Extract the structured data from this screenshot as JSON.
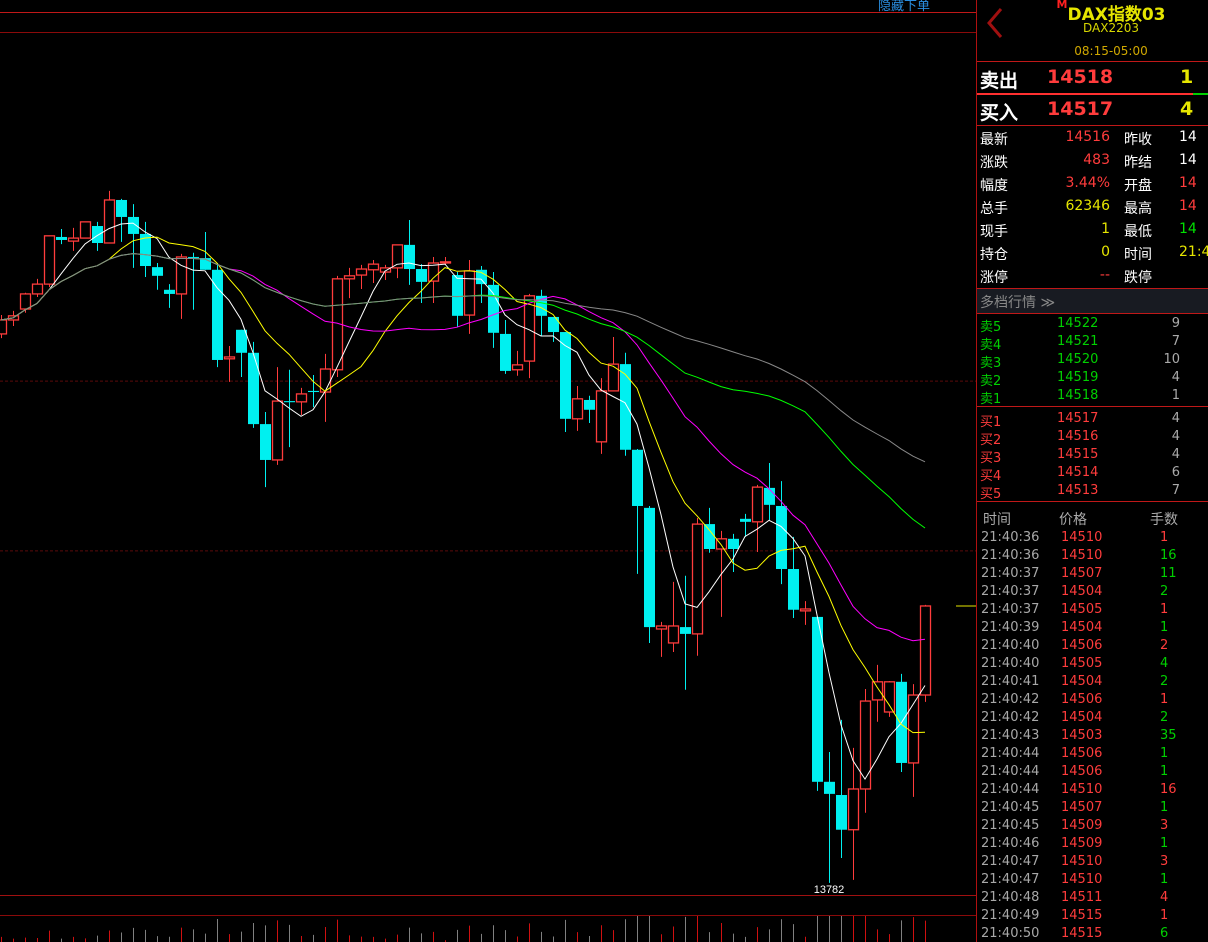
{
  "toolbar": {
    "hide_order_label": "隐藏下单"
  },
  "colors": {
    "up": "#ff3c3c",
    "down": "#00f0f0",
    "ma5": "#ffffff",
    "ma10": "#ffff00",
    "ma20": "#ff00ff",
    "ma40": "#00ff00",
    "ma60": "#888888",
    "grid": "#5a0a0a"
  },
  "header": {
    "flag": "M",
    "title": "DAX指数03",
    "code": "DAX2203",
    "session": "08:15-05:00"
  },
  "quote": {
    "ask": {
      "label": "卖出",
      "price": "14518",
      "volume": "1"
    },
    "bid": {
      "label": "买入",
      "price": "14517",
      "volume": "4"
    }
  },
  "info": [
    {
      "l1": "最新",
      "v1": "14516",
      "c1": "#ff3c3c",
      "l2": "昨收",
      "v2": "14",
      "c2": "#ffffff"
    },
    {
      "l1": "涨跌",
      "v1": "483",
      "c1": "#ff3c3c",
      "l2": "昨结",
      "v2": "14",
      "c2": "#ffffff"
    },
    {
      "l1": "幅度",
      "v1": "3.44%",
      "c1": "#ff3c3c",
      "l2": "开盘",
      "v2": "14",
      "c2": "#ff3c3c"
    },
    {
      "l1": "总手",
      "v1": "62346",
      "c1": "#e6e600",
      "l2": "最高",
      "v2": "14",
      "c2": "#ff3c3c"
    },
    {
      "l1": "现手",
      "v1": "1",
      "c1": "#e6e600",
      "l2": "最低",
      "v2": "14",
      "c2": "#00e000"
    },
    {
      "l1": "持仓",
      "v1": "0",
      "c1": "#e6e600",
      "l2": "时间",
      "v2": "21:4",
      "c2": "#e6e600"
    },
    {
      "l1": "涨停",
      "v1": "--",
      "c1": "#ff3c3c",
      "l2": "跌停",
      "v2": "",
      "c2": "#ffffff"
    }
  ],
  "depth": {
    "title": "多档行情 ≫",
    "asks": [
      {
        "label": "卖5",
        "price": "14522",
        "volume": "9"
      },
      {
        "label": "卖4",
        "price": "14521",
        "volume": "7"
      },
      {
        "label": "卖3",
        "price": "14520",
        "volume": "10"
      },
      {
        "label": "卖2",
        "price": "14519",
        "volume": "4"
      },
      {
        "label": "卖1",
        "price": "14518",
        "volume": "1"
      }
    ],
    "bids": [
      {
        "label": "买1",
        "price": "14517",
        "volume": "4"
      },
      {
        "label": "买2",
        "price": "14516",
        "volume": "4"
      },
      {
        "label": "买3",
        "price": "14515",
        "volume": "4"
      },
      {
        "label": "买4",
        "price": "14514",
        "volume": "6"
      },
      {
        "label": "买5",
        "price": "14513",
        "volume": "7"
      }
    ]
  },
  "trades": {
    "headers": {
      "time": "时间",
      "price": "价格",
      "volume": "手数"
    },
    "rows": [
      {
        "time": "21:40:36",
        "price": "14510",
        "volume": "1",
        "side": "up"
      },
      {
        "time": "21:40:36",
        "price": "14510",
        "volume": "16",
        "side": "down"
      },
      {
        "time": "21:40:37",
        "price": "14507",
        "volume": "11",
        "side": "down"
      },
      {
        "time": "21:40:37",
        "price": "14504",
        "volume": "2",
        "side": "down"
      },
      {
        "time": "21:40:37",
        "price": "14505",
        "volume": "1",
        "side": "up"
      },
      {
        "time": "21:40:39",
        "price": "14504",
        "volume": "1",
        "side": "down"
      },
      {
        "time": "21:40:40",
        "price": "14506",
        "volume": "2",
        "side": "up"
      },
      {
        "time": "21:40:40",
        "price": "14505",
        "volume": "4",
        "side": "down"
      },
      {
        "time": "21:40:41",
        "price": "14504",
        "volume": "2",
        "side": "down"
      },
      {
        "time": "21:40:42",
        "price": "14506",
        "volume": "1",
        "side": "up"
      },
      {
        "time": "21:40:42",
        "price": "14504",
        "volume": "2",
        "side": "down"
      },
      {
        "time": "21:40:43",
        "price": "14503",
        "volume": "35",
        "side": "down"
      },
      {
        "time": "21:40:44",
        "price": "14506",
        "volume": "1",
        "side": "down"
      },
      {
        "time": "21:40:44",
        "price": "14506",
        "volume": "1",
        "side": "down"
      },
      {
        "time": "21:40:44",
        "price": "14510",
        "volume": "16",
        "side": "up"
      },
      {
        "time": "21:40:45",
        "price": "14507",
        "volume": "1",
        "side": "down"
      },
      {
        "time": "21:40:45",
        "price": "14509",
        "volume": "3",
        "side": "up"
      },
      {
        "time": "21:40:46",
        "price": "14509",
        "volume": "1",
        "side": "down"
      },
      {
        "time": "21:40:47",
        "price": "14510",
        "volume": "3",
        "side": "up"
      },
      {
        "time": "21:40:47",
        "price": "14510",
        "volume": "1",
        "side": "down"
      },
      {
        "time": "21:40:48",
        "price": "14511",
        "volume": "4",
        "side": "up"
      },
      {
        "time": "21:40:49",
        "price": "14515",
        "volume": "1",
        "side": "up"
      },
      {
        "time": "21:40:50",
        "price": "14515",
        "volume": "6",
        "side": "down"
      }
    ]
  },
  "chart_data": {
    "type": "candlestick",
    "ylim": [
      13750,
      16122
    ],
    "grid_levels": [
      15112,
      14662
    ],
    "last_price": 14516,
    "low_label": "13782",
    "moving_averages": [
      5,
      10,
      20,
      40,
      60
    ],
    "ohlc": [
      [
        15237,
        15287,
        15226,
        15274
      ],
      [
        15274,
        15298,
        15258,
        15285
      ],
      [
        15303,
        15346,
        15293,
        15343
      ],
      [
        15343,
        15383,
        15335,
        15369
      ],
      [
        15369,
        15497,
        15361,
        15497
      ],
      [
        15494,
        15515,
        15475,
        15486
      ],
      [
        15483,
        15518,
        15457,
        15491
      ],
      [
        15491,
        15534,
        15491,
        15534
      ],
      [
        15523,
        15534,
        15457,
        15478
      ],
      [
        15478,
        15616,
        15478,
        15592
      ],
      [
        15592,
        15595,
        15481,
        15547
      ],
      [
        15547,
        15581,
        15412,
        15502
      ],
      [
        15502,
        15534,
        15388,
        15417
      ],
      [
        15414,
        15425,
        15354,
        15391
      ],
      [
        15354,
        15369,
        15306,
        15343
      ],
      [
        15343,
        15449,
        15277,
        15441
      ],
      [
        15441,
        15452,
        15301,
        15439
      ],
      [
        15438,
        15507,
        15407,
        15407
      ],
      [
        15407,
        15425,
        15149,
        15168
      ],
      [
        15171,
        15205,
        15110,
        15176
      ],
      [
        15248,
        15248,
        15123,
        15187
      ],
      [
        15187,
        15216,
        14988,
        14998
      ],
      [
        14998,
        15030,
        14831,
        14903
      ],
      [
        14903,
        15149,
        14890,
        15059
      ],
      [
        15059,
        15142,
        14937,
        15056
      ],
      [
        15057,
        15094,
        15022,
        15078
      ],
      [
        15086,
        15128,
        15043,
        15083
      ],
      [
        15083,
        15184,
        15004,
        15144
      ],
      [
        15142,
        15391,
        15123,
        15383
      ],
      [
        15383,
        15412,
        15332,
        15391
      ],
      [
        15393,
        15420,
        15356,
        15409
      ],
      [
        15407,
        15433,
        15372,
        15422
      ],
      [
        15401,
        15420,
        15380,
        15412
      ],
      [
        15412,
        15473,
        15385,
        15473
      ],
      [
        15473,
        15539,
        15367,
        15409
      ],
      [
        15409,
        15422,
        15319,
        15375
      ],
      [
        15377,
        15441,
        15319,
        15425
      ],
      [
        15425,
        15441,
        15420,
        15428
      ],
      [
        15393,
        15401,
        15255,
        15285
      ],
      [
        15287,
        15433,
        15237,
        15404
      ],
      [
        15407,
        15417,
        15319,
        15369
      ],
      [
        15367,
        15401,
        15200,
        15240
      ],
      [
        15237,
        15274,
        15131,
        15139
      ],
      [
        15142,
        15192,
        15126,
        15155
      ],
      [
        15165,
        15343,
        15120,
        15338
      ],
      [
        15338,
        15354,
        15232,
        15285
      ],
      [
        15282,
        15282,
        15216,
        15242
      ],
      [
        15242,
        15242,
        14977,
        15012
      ],
      [
        15012,
        15099,
        14980,
        15065
      ],
      [
        15062,
        15073,
        15001,
        15036
      ],
      [
        14951,
        15120,
        14919,
        15086
      ],
      [
        15086,
        15229,
        15086,
        15157
      ],
      [
        15157,
        15187,
        14914,
        14930
      ],
      [
        14930,
        14932,
        14601,
        14781
      ],
      [
        14776,
        14781,
        14418,
        14460
      ],
      [
        14455,
        14474,
        14381,
        14463
      ],
      [
        14418,
        14580,
        14394,
        14463
      ],
      [
        14460,
        14596,
        14294,
        14442
      ],
      [
        14442,
        14749,
        14384,
        14733
      ],
      [
        14733,
        14776,
        14657,
        14667
      ],
      [
        14667,
        14715,
        14487,
        14694
      ],
      [
        14694,
        14707,
        14606,
        14667
      ],
      [
        14747,
        14760,
        14699,
        14739
      ],
      [
        14739,
        14837,
        14659,
        14831
      ],
      [
        14829,
        14895,
        14744,
        14784
      ],
      [
        14781,
        14847,
        14574,
        14614
      ],
      [
        14614,
        14699,
        14484,
        14506
      ],
      [
        14503,
        14529,
        14466,
        14508
      ],
      [
        14487,
        14487,
        14026,
        14050
      ],
      [
        14050,
        14129,
        13782,
        14018
      ],
      [
        14015,
        14214,
        13848,
        13923
      ],
      [
        13923,
        14140,
        13790,
        14031
      ],
      [
        14031,
        14296,
        13968,
        14264
      ],
      [
        14267,
        14360,
        14209,
        14315
      ],
      [
        14235,
        14317,
        14222,
        14315
      ],
      [
        14315,
        14336,
        14076,
        14100
      ],
      [
        14100,
        14309,
        14010,
        14280
      ],
      [
        14280,
        14519,
        14262,
        14516
      ]
    ]
  }
}
